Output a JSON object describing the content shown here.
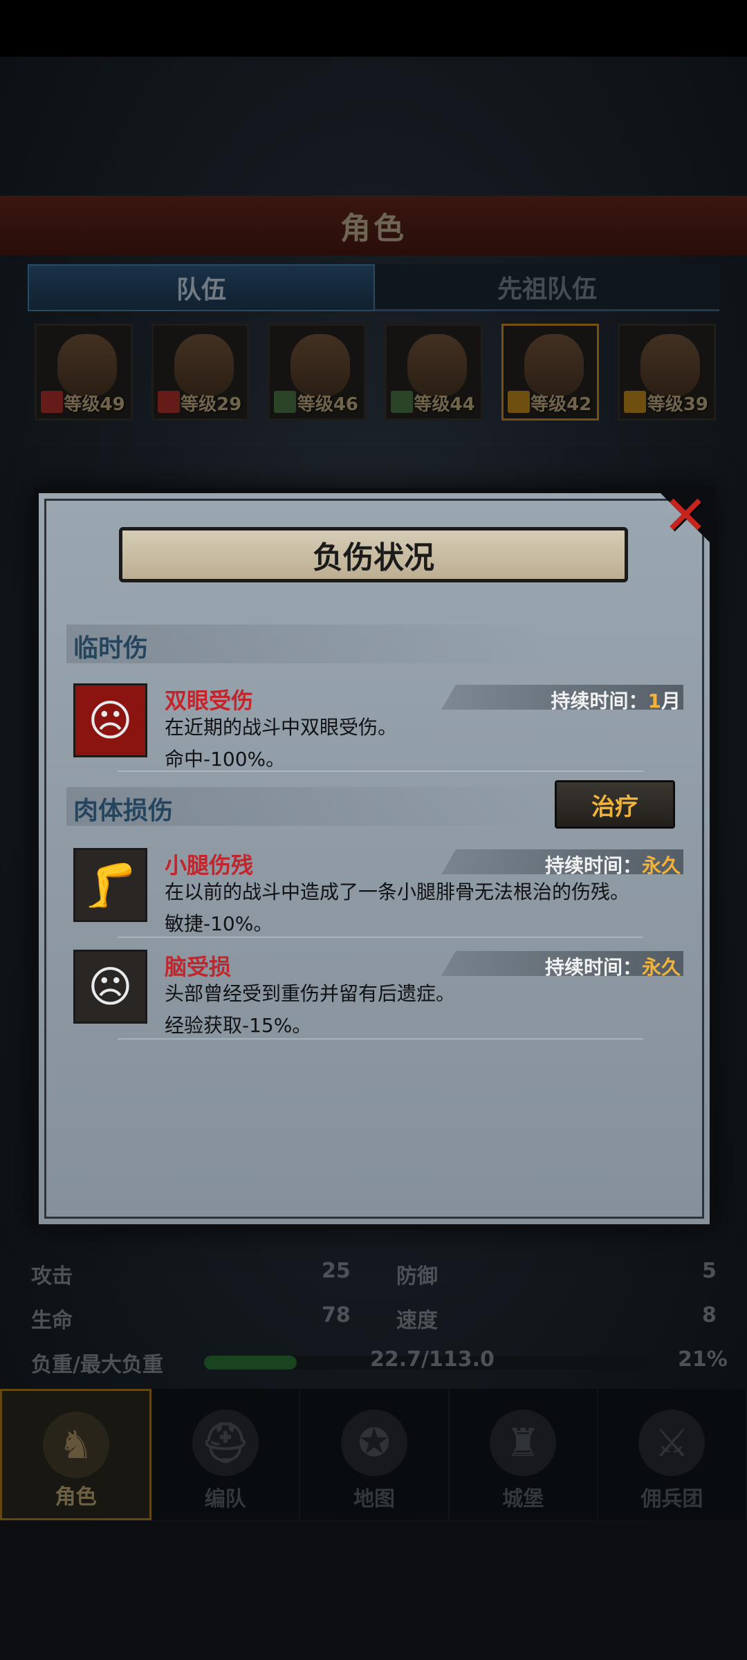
{
  "app": {
    "screen_title": "角色"
  },
  "tabs": [
    {
      "label": "队伍",
      "active": true
    },
    {
      "label": "先祖队伍",
      "active": false
    }
  ],
  "roster": [
    {
      "level_label": "等级49",
      "selected": false,
      "badge_color": "#b8322a"
    },
    {
      "level_label": "等级29",
      "selected": false,
      "badge_color": "#b8322a"
    },
    {
      "level_label": "等级46",
      "selected": false,
      "badge_color": "#4f7a46"
    },
    {
      "level_label": "等级44",
      "selected": false,
      "badge_color": "#4f7a46"
    },
    {
      "level_label": "等级42",
      "selected": true,
      "badge_color": "#c8901e"
    },
    {
      "level_label": "等级39",
      "selected": false,
      "badge_color": "#c8901e"
    }
  ],
  "modal": {
    "title": "负伤状况",
    "close_icon": "close-icon",
    "temporary": {
      "heading": "临时伤",
      "items": [
        {
          "name": "双眼受伤",
          "desc": "在近期的战斗中双眼受伤。",
          "effect": "命中-100%。",
          "duration_label": "持续时间：",
          "duration_value": "1",
          "duration_unit": "月",
          "icon": "bandaged-head-icon"
        }
      ]
    },
    "permanent": {
      "heading": "肉体损伤",
      "heal_label": "治疗",
      "items": [
        {
          "name": "小腿伤残",
          "desc": "在以前的战斗中造成了一条小腿腓骨无法根治的伤残。",
          "effect": "敏捷-10%。",
          "duration_label": "持续时间：",
          "duration_value": "永久",
          "icon": "bandaged-leg-icon"
        },
        {
          "name": "脑受损",
          "desc": "头部曾经受到重伤并留有后遗症。",
          "effect": "经验获取-15%。",
          "duration_label": "持续时间：",
          "duration_value": "永久",
          "icon": "injured-head-icon"
        }
      ]
    }
  },
  "stats": {
    "attack_label": "攻击",
    "attack": "25",
    "defense_label": "防御",
    "defense": "5",
    "hp_label": "生命",
    "hp": "78",
    "speed_label": "速度",
    "speed": "8",
    "load_label": "负重/最大负重",
    "load_value": "22.7/113.0",
    "load_percent": "21%",
    "load_fraction": 0.21
  },
  "nav": [
    {
      "label": "角色",
      "active": true,
      "icon": "knight-icon"
    },
    {
      "label": "编队",
      "active": false,
      "icon": "helmet-icon"
    },
    {
      "label": "地图",
      "active": false,
      "icon": "compass-map-icon"
    },
    {
      "label": "城堡",
      "active": false,
      "icon": "castle-icon"
    },
    {
      "label": "佣兵团",
      "active": false,
      "icon": "mercenary-icon"
    }
  ],
  "colors": {
    "accent_orange": "#f2b33a",
    "injury_red": "#c2252b",
    "close_red": "#c8231c"
  }
}
